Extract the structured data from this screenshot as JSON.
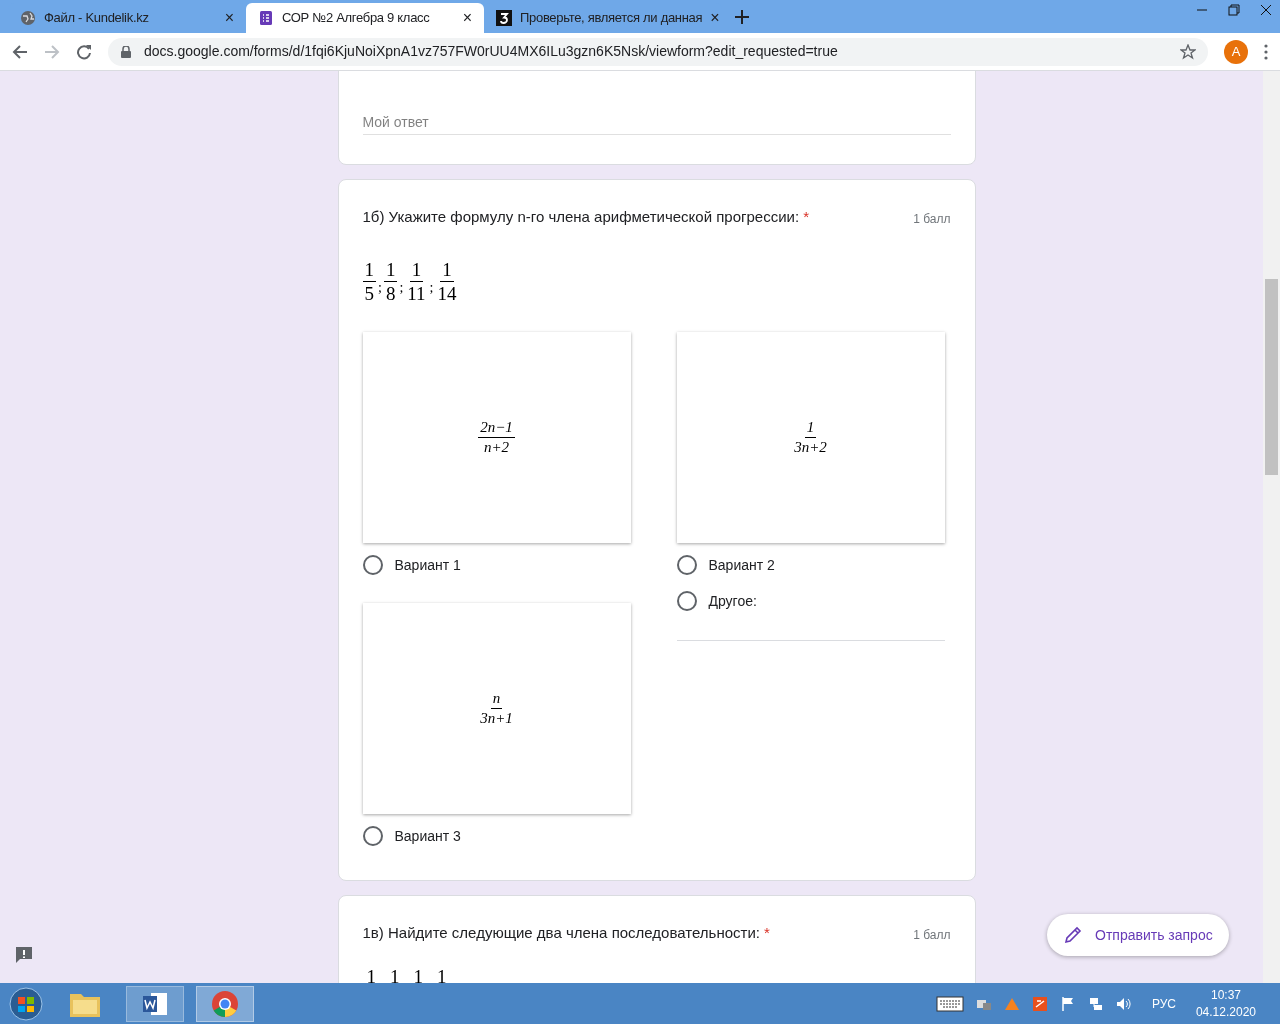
{
  "browser": {
    "tabs": [
      {
        "title": "Файл - Kundelik.kz",
        "selected": false,
        "kind": "globe"
      },
      {
        "title": "СОР №2 Алгебра 9 класс",
        "selected": true,
        "kind": "forms"
      },
      {
        "title": "Проверьте, является ли данная",
        "selected": false,
        "kind": "three"
      }
    ],
    "tab_close": "×",
    "url": "docs.google.com/forms/d/1fqi6KjuNoiXpnA1vz757FW0rUU4MX6ILu3gzn6K5Nsk/viewform?edit_requested=true",
    "avatar": "A"
  },
  "form": {
    "answer_card": {
      "placeholder": "Мой ответ"
    },
    "question": {
      "title": "1б) Укажите формулу n-го члена арифметической прогрессии:",
      "required": "*",
      "points": "1 балл",
      "separator": ";",
      "sequence": [
        {
          "num": "1",
          "den": "5"
        },
        {
          "num": "1",
          "den": "8"
        },
        {
          "num": "1",
          "den": "11"
        },
        {
          "num": "1",
          "den": "14"
        }
      ],
      "options": [
        {
          "num": "2n−1",
          "den": "n+2",
          "label": "Вариант 1",
          "selected": false
        },
        {
          "num": "1",
          "den": "3n+2",
          "label": "Вариант 2",
          "selected": false
        },
        {
          "num": "n",
          "den": "3n+1",
          "label": "Вариант 3",
          "selected": false
        }
      ],
      "other": {
        "label": "Другое:",
        "selected": false
      }
    },
    "next_question": {
      "title": "1в) Найдите следующие два члена последовательности:",
      "required": "*",
      "points": "1 балл",
      "numerators": [
        "1",
        "1",
        "1",
        "1"
      ]
    },
    "request_button": "Отправить запрос"
  },
  "taskbar": {
    "language": "РУС",
    "time": "10:37",
    "date": "04.12.2020"
  }
}
